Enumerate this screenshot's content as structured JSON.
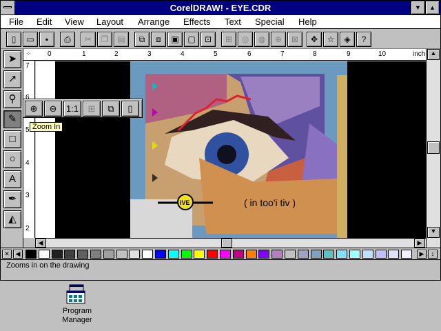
{
  "window": {
    "title": "CorelDRAW! - EYE.CDR",
    "min_glyph": "▼",
    "max_glyph": "▲"
  },
  "menubar": [
    "File",
    "Edit",
    "View",
    "Layout",
    "Arrange",
    "Effects",
    "Text",
    "Special",
    "Help"
  ],
  "toolbar_icons": [
    "new-icon",
    "open-icon",
    "save-icon",
    "print-icon",
    "cut-icon",
    "copy-icon",
    "paste-icon",
    "group-icon",
    "ungroup-icon",
    "wireframe-icon",
    "full-screen-icon",
    "import-icon",
    "align-icon",
    "rotate-icon",
    "curve-icon",
    "weld-icon",
    "node-icon",
    "move-icon",
    "star-icon",
    "contour-icon",
    "help-icon"
  ],
  "toolbox": [
    "pick-tool",
    "shape-tool",
    "zoom-tool",
    "pencil-tool",
    "rectangle-tool",
    "ellipse-tool",
    "text-tool",
    "outline-tool",
    "fill-tool"
  ],
  "ruler": {
    "units": "inches",
    "h_ticks": [
      "0",
      "1",
      "2",
      "3",
      "4",
      "5",
      "6",
      "7",
      "8",
      "9",
      "10"
    ],
    "v_ticks": [
      "7",
      "6",
      "5",
      "4",
      "3",
      "2"
    ]
  },
  "zoom_flyout": {
    "one_to_one": "1:1"
  },
  "tooltip": "Zoom In",
  "artwork": {
    "text": "( in too'i tiv )",
    "label": "IVE"
  },
  "palette": [
    "#000000",
    "#ffffff",
    "#202020",
    "#404040",
    "#606060",
    "#808080",
    "#a0a0a0",
    "#c0c0c0",
    "#e0e0e0",
    "#ffffff",
    "#0000ff",
    "#00ffff",
    "#00ff00",
    "#ffff00",
    "#ff0000",
    "#ff00ff",
    "#c00080",
    "#ff8000",
    "#8000ff",
    "#b080c0",
    "#c0c0c0",
    "#a0a0c0",
    "#80a0c0",
    "#60c0c0",
    "#80e0ff",
    "#a0ffff",
    "#c0e0ff",
    "#c0c0ff",
    "#e0e0ff",
    "#f0f0ff"
  ],
  "status": {
    "message": "Zooms in on the drawing"
  },
  "desktop": {
    "program_manager": [
      "Program",
      "Manager"
    ]
  }
}
